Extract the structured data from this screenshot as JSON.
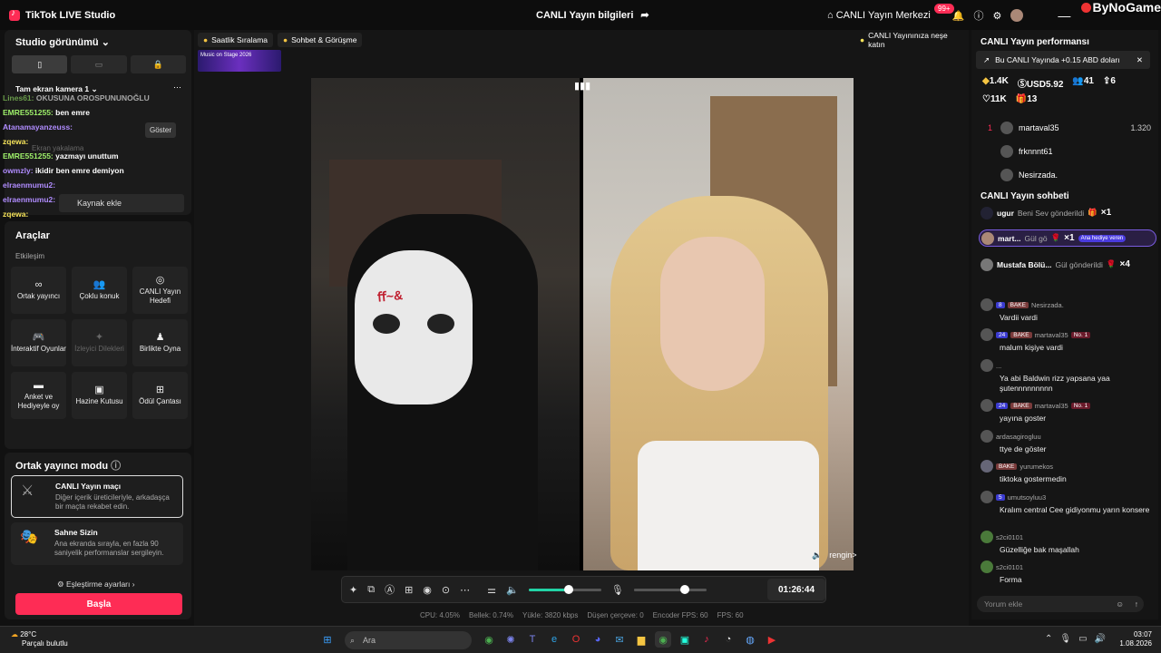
{
  "app": {
    "title": "TikTok LIVE Studio",
    "watermark": "ByNoGame"
  },
  "header": {
    "live_info": "CANLI Yayın bilgileri",
    "live_center": "CANLI Yayın Merkezi",
    "notif_count": "99+"
  },
  "studio": {
    "title": "Studio görünümü",
    "scene": "Tam ekran kamera 1",
    "chat_overlay": [
      {
        "user": "Lines61:",
        "text": "OKUSUNA OROSPUNUNOĞLU"
      },
      {
        "user": "EMRE551255:",
        "text": "ben emre"
      },
      {
        "user": "Atanamayanzeuss:",
        "text": ""
      },
      {
        "user": "zqewa:",
        "text": ""
      },
      {
        "user": "EMRE551255:",
        "text": "yazmayı unuttum"
      },
      {
        "user": "owmzly:",
        "text": "ikidir ben emre demiyon"
      },
      {
        "user": "elraenmumu2:",
        "text": ""
      },
      {
        "user": "elraenmumu2:",
        "text": ""
      },
      {
        "user": "zqewa:",
        "text": ""
      }
    ],
    "hidden_source": "Ekran yakalama",
    "show_btn": "Göster",
    "add_source": "Kaynak ekle"
  },
  "tools": {
    "title": "Araçlar",
    "section": "Etkileşim",
    "items": [
      {
        "label": "Ortak yayıncı",
        "icon": "link-icon",
        "disabled": false
      },
      {
        "label": "Çoklu konuk",
        "icon": "users-icon",
        "disabled": false
      },
      {
        "label": "CANLI Yayın Hedefi",
        "icon": "target-icon",
        "disabled": false
      },
      {
        "label": "İnteraktif Oyunlar",
        "icon": "gamepad-icon",
        "disabled": false
      },
      {
        "label": "İzleyici Dilekleri",
        "icon": "wish-icon",
        "disabled": true
      },
      {
        "label": "Birlikte Oyna",
        "icon": "play-together-icon",
        "disabled": false
      },
      {
        "label": "Anket ve Hediyeyle oy",
        "icon": "poll-icon",
        "disabled": false
      },
      {
        "label": "Hazine Kutusu",
        "icon": "treasure-icon",
        "disabled": false
      },
      {
        "label": "Ödül Çantası",
        "icon": "bag-icon",
        "disabled": false
      }
    ]
  },
  "cohost": {
    "title": "Ortak yayıncı modu",
    "cards": [
      {
        "title": "CANLI Yayın maçı",
        "desc": "Diğer içerik üreticileriyle, arkadaşça bir maçta rekabet edin."
      },
      {
        "title": "Sahne Sizin",
        "desc": "Ana ekranda sırayla, en fazla 90 saniyelik performanslar sergileyin."
      }
    ],
    "match_settings": "Eşleştirme ayarları",
    "start": "Başla"
  },
  "center": {
    "pills": [
      "Saatlik Sıralama",
      "Sohbet & Görüşme"
    ],
    "tip": "CANLI Yayınınıza neşe katın",
    "banner": "Music on Stage 2026",
    "guest_name": "rengin>",
    "timer": "01:26:44",
    "stats": [
      {
        "label": "CPU:",
        "value": "4.05%"
      },
      {
        "label": "Bellek:",
        "value": "0.74%"
      },
      {
        "label": "Yükle:",
        "value": "3820 kbps"
      },
      {
        "label": "Düşen çerçeve:",
        "value": "0"
      },
      {
        "label": "Encoder FPS:",
        "value": "60"
      },
      {
        "label": "FPS:",
        "value": "60"
      }
    ],
    "volume_level": 0.55,
    "mic_level": 0.7
  },
  "performance": {
    "title": "CANLI Yayın performansı",
    "notice": "Bu CANLI Yayında +0.15 ABD doları",
    "metrics": [
      {
        "icon": "diamond-icon",
        "value": "1.4K"
      },
      {
        "icon": "coin-icon",
        "value": "USD5.92"
      },
      {
        "icon": "viewers-icon",
        "value": "41"
      },
      {
        "icon": "share-icon",
        "value": "6"
      },
      {
        "icon": "heart-icon",
        "value": "11K"
      },
      {
        "icon": "gift-icon",
        "value": "13"
      }
    ],
    "ranking": [
      {
        "rank": "1",
        "name": "martaval35",
        "score": "1.320"
      },
      {
        "rank": "",
        "name": "frknnnt61",
        "score": ""
      },
      {
        "rank": "",
        "name": "Nesirzada.",
        "score": ""
      }
    ]
  },
  "livechat": {
    "title": "CANLI Yayın sohbeti",
    "gifts": [
      {
        "user": "ugur",
        "text": "Beni Sev gönderildi",
        "count": "×1",
        "tag": ""
      },
      {
        "user": "mart...",
        "text": "Gül gö",
        "count": "×1",
        "tag": "Ana hediye veren"
      },
      {
        "user": "Mustafa Bölü...",
        "text": "Gül gönderildi",
        "count": "×4",
        "tag": ""
      }
    ],
    "messages": [
      {
        "level": "8",
        "badge": "BAKE",
        "user": "Nesirzada.",
        "rank": "",
        "text": "Vardii vardi"
      },
      {
        "level": "24",
        "badge": "BAKE",
        "user": "martaval35",
        "rank": "No. 1",
        "text": "malum kişiye vardi"
      },
      {
        "level": "",
        "badge": "",
        "user": "...",
        "rank": "",
        "text": "Ya abi Baldwin rizz yapsana yaa şutennnnnnnnn"
      },
      {
        "level": "24",
        "badge": "BAKE",
        "user": "martaval35",
        "rank": "No. 1",
        "text": "yayına goster"
      },
      {
        "level": "",
        "badge": "",
        "user": "ardasagirogluu",
        "rank": "",
        "text": "ttye de göster"
      },
      {
        "level": "",
        "badge": "BAKE",
        "user": "yurumekos",
        "rank": "",
        "text": "tiktoka gostermedin"
      },
      {
        "level": "5",
        "badge": "",
        "user": "umutsoyluu3",
        "rank": "",
        "text": "Kralım central Cee gidiyonmu yarın konsere"
      },
      {
        "level": "",
        "badge": "",
        "user": "s2ci0101",
        "rank": "",
        "text": "Güzelliğe bak maşallah"
      },
      {
        "level": "",
        "badge": "",
        "user": "s2ci0101",
        "rank": "",
        "text": "Forma"
      }
    ],
    "placeholder": "Yorum ekle"
  },
  "taskbar": {
    "temp": "28°C",
    "weather": "Parçalı bulutlu",
    "search": "Ara",
    "time": "03:07",
    "date": "1.08.2026"
  },
  "colors": {
    "accent": "#fe2c55",
    "audio": "#22d3a6"
  }
}
